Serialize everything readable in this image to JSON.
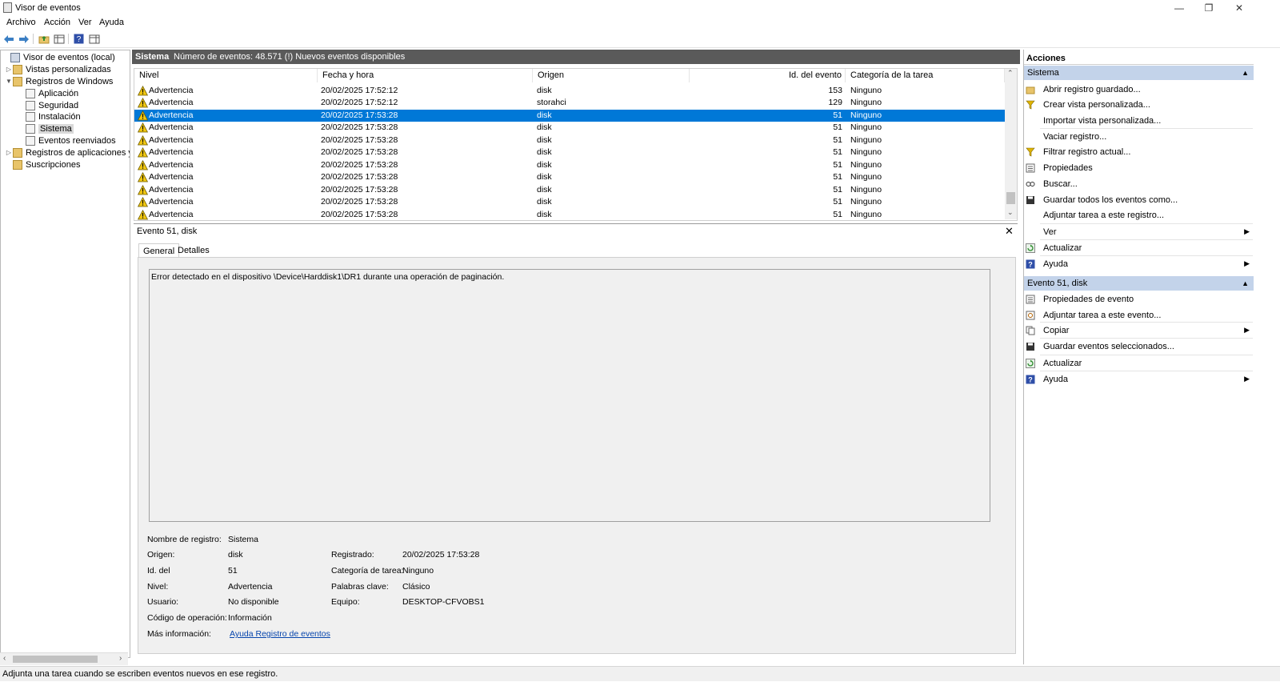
{
  "window": {
    "title": "Visor de eventos"
  },
  "menu": [
    "Archivo",
    "Acción",
    "Ver",
    "Ayuda"
  ],
  "tree": {
    "items": [
      {
        "label": "Visor de eventos (local)"
      },
      {
        "label": "Vistas personalizadas"
      },
      {
        "label": "Registros de Windows"
      },
      {
        "label": "Aplicación"
      },
      {
        "label": "Seguridad"
      },
      {
        "label": "Instalación"
      },
      {
        "label": "Sistema"
      },
      {
        "label": "Eventos reenviados"
      },
      {
        "label": "Registros de aplicaciones y s"
      },
      {
        "label": "Suscripciones"
      }
    ]
  },
  "center": {
    "title": "Sistema",
    "count": "Número de eventos: 48.571 (!) Nuevos eventos disponibles"
  },
  "grid": {
    "columns": [
      "Nivel",
      "Fecha y hora",
      "Origen",
      "Id. del evento",
      "Categoría de la tarea"
    ],
    "rows": [
      {
        "nivel": "Advertencia",
        "fecha": "20/02/2025 17:52:12",
        "origen": "disk",
        "id": "153",
        "cat": "Ninguno"
      },
      {
        "nivel": "Advertencia",
        "fecha": "20/02/2025 17:52:12",
        "origen": "storahci",
        "id": "129",
        "cat": "Ninguno"
      },
      {
        "nivel": "Advertencia",
        "fecha": "20/02/2025 17:53:28",
        "origen": "disk",
        "id": "51",
        "cat": "Ninguno"
      },
      {
        "nivel": "Advertencia",
        "fecha": "20/02/2025 17:53:28",
        "origen": "disk",
        "id": "51",
        "cat": "Ninguno"
      },
      {
        "nivel": "Advertencia",
        "fecha": "20/02/2025 17:53:28",
        "origen": "disk",
        "id": "51",
        "cat": "Ninguno"
      },
      {
        "nivel": "Advertencia",
        "fecha": "20/02/2025 17:53:28",
        "origen": "disk",
        "id": "51",
        "cat": "Ninguno"
      },
      {
        "nivel": "Advertencia",
        "fecha": "20/02/2025 17:53:28",
        "origen": "disk",
        "id": "51",
        "cat": "Ninguno"
      },
      {
        "nivel": "Advertencia",
        "fecha": "20/02/2025 17:53:28",
        "origen": "disk",
        "id": "51",
        "cat": "Ninguno"
      },
      {
        "nivel": "Advertencia",
        "fecha": "20/02/2025 17:53:28",
        "origen": "disk",
        "id": "51",
        "cat": "Ninguno"
      },
      {
        "nivel": "Advertencia",
        "fecha": "20/02/2025 17:53:28",
        "origen": "disk",
        "id": "51",
        "cat": "Ninguno"
      },
      {
        "nivel": "Advertencia",
        "fecha": "20/02/2025 17:53:28",
        "origen": "disk",
        "id": "51",
        "cat": "Ninguno"
      }
    ]
  },
  "detail": {
    "title": "Evento 51, disk",
    "tabs": [
      "General",
      "Detalles"
    ],
    "description": "Error detectado en el dispositivo \\Device\\Harddisk1\\DR1 durante una operación de paginación.",
    "fields": {
      "log_name_label": "Nombre de registro:",
      "log_name": "Sistema",
      "source_label": "Origen:",
      "source": "disk",
      "logged_label": "Registrado:",
      "logged": "20/02/2025 17:53:28",
      "id_label": "Id. del",
      "id": "51",
      "category_label": "Categoría de tarea:",
      "category": "Ninguno",
      "level_label": "Nivel:",
      "level": "Advertencia",
      "keywords_label": "Palabras clave:",
      "keywords": "Clásico",
      "user_label": "Usuario:",
      "user": "No disponible",
      "computer_label": "Equipo:",
      "computer": "DESKTOP-CFVOBS1",
      "opcode_label": "Código de operación:",
      "opcode": "Información",
      "more_label": "Más información:",
      "more_link": "Ayuda Registro de eventos"
    }
  },
  "actions": {
    "title": "Acciones",
    "group1": "Sistema",
    "group1_items": [
      "Abrir registro guardado...",
      "Crear vista personalizada...",
      "Importar vista personalizada...",
      "Vaciar registro...",
      "Filtrar registro actual...",
      "Propiedades",
      "Buscar...",
      "Guardar todos los eventos como...",
      "Adjuntar tarea a este registro...",
      "Ver",
      "Actualizar",
      "Ayuda"
    ],
    "group2": "Evento 51, disk",
    "group2_items": [
      "Propiedades de evento",
      "Adjuntar tarea a este evento...",
      "Copiar",
      "Guardar eventos seleccionados...",
      "Actualizar",
      "Ayuda"
    ]
  },
  "status": "Adjunta una tarea cuando se escriben eventos nuevos en ese registro.",
  "colors": {
    "selection": "#0078d7",
    "header_dark": "#5a5a5a",
    "action_group": "#c3d3ea",
    "warning": "#f2c811"
  }
}
